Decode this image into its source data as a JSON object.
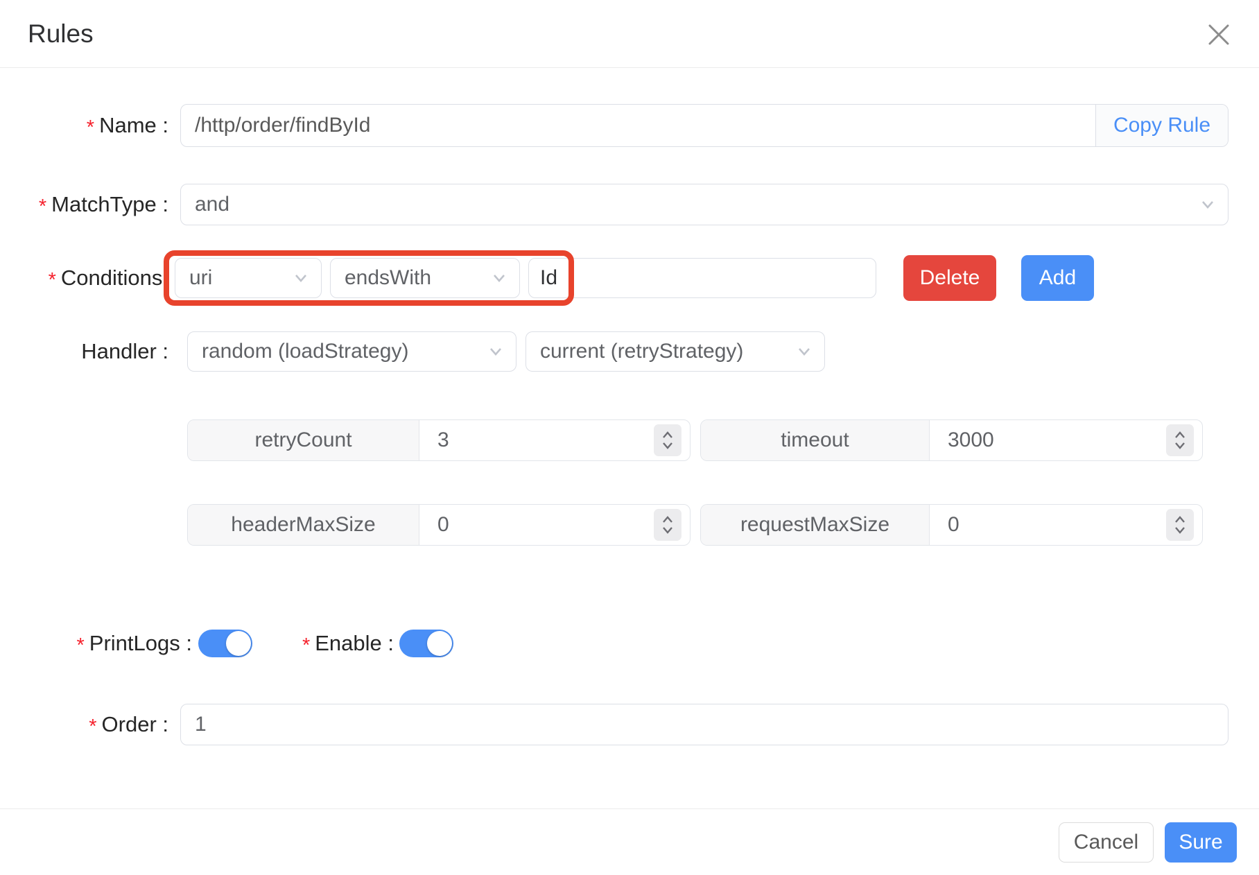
{
  "dialog": {
    "title": "Rules"
  },
  "ui": {
    "required_marker": "*"
  },
  "form": {
    "name": {
      "label": "Name :",
      "value": "/http/order/findById",
      "copy_button": "Copy Rule"
    },
    "match_type": {
      "label": "MatchType :",
      "value": "and"
    },
    "conditions": {
      "label": "Conditions:",
      "key": "uri",
      "operator": "endsWith",
      "value": "Id",
      "delete_button": "Delete",
      "add_button": "Add"
    },
    "handler": {
      "label": "Handler :",
      "load_strategy": "random (loadStrategy)",
      "retry_strategy": "current (retryStrategy)"
    },
    "params": [
      {
        "name": "retryCount",
        "value": "3"
      },
      {
        "name": "timeout",
        "value": "3000"
      },
      {
        "name": "headerMaxSize",
        "value": "0"
      },
      {
        "name": "requestMaxSize",
        "value": "0"
      }
    ],
    "print_logs": {
      "label": "PrintLogs :",
      "state": "on"
    },
    "enable": {
      "label": "Enable :",
      "state": "on"
    },
    "order": {
      "label": "Order :",
      "value": "1"
    }
  },
  "footer": {
    "cancel": "Cancel",
    "sure": "Sure"
  },
  "colors": {
    "primary_blue": "#4a8ff7",
    "danger_red": "#e5463d",
    "annotation_red": "#e8432c",
    "toggle_on": "#4a8ff7",
    "required_red": "#f5222d"
  }
}
